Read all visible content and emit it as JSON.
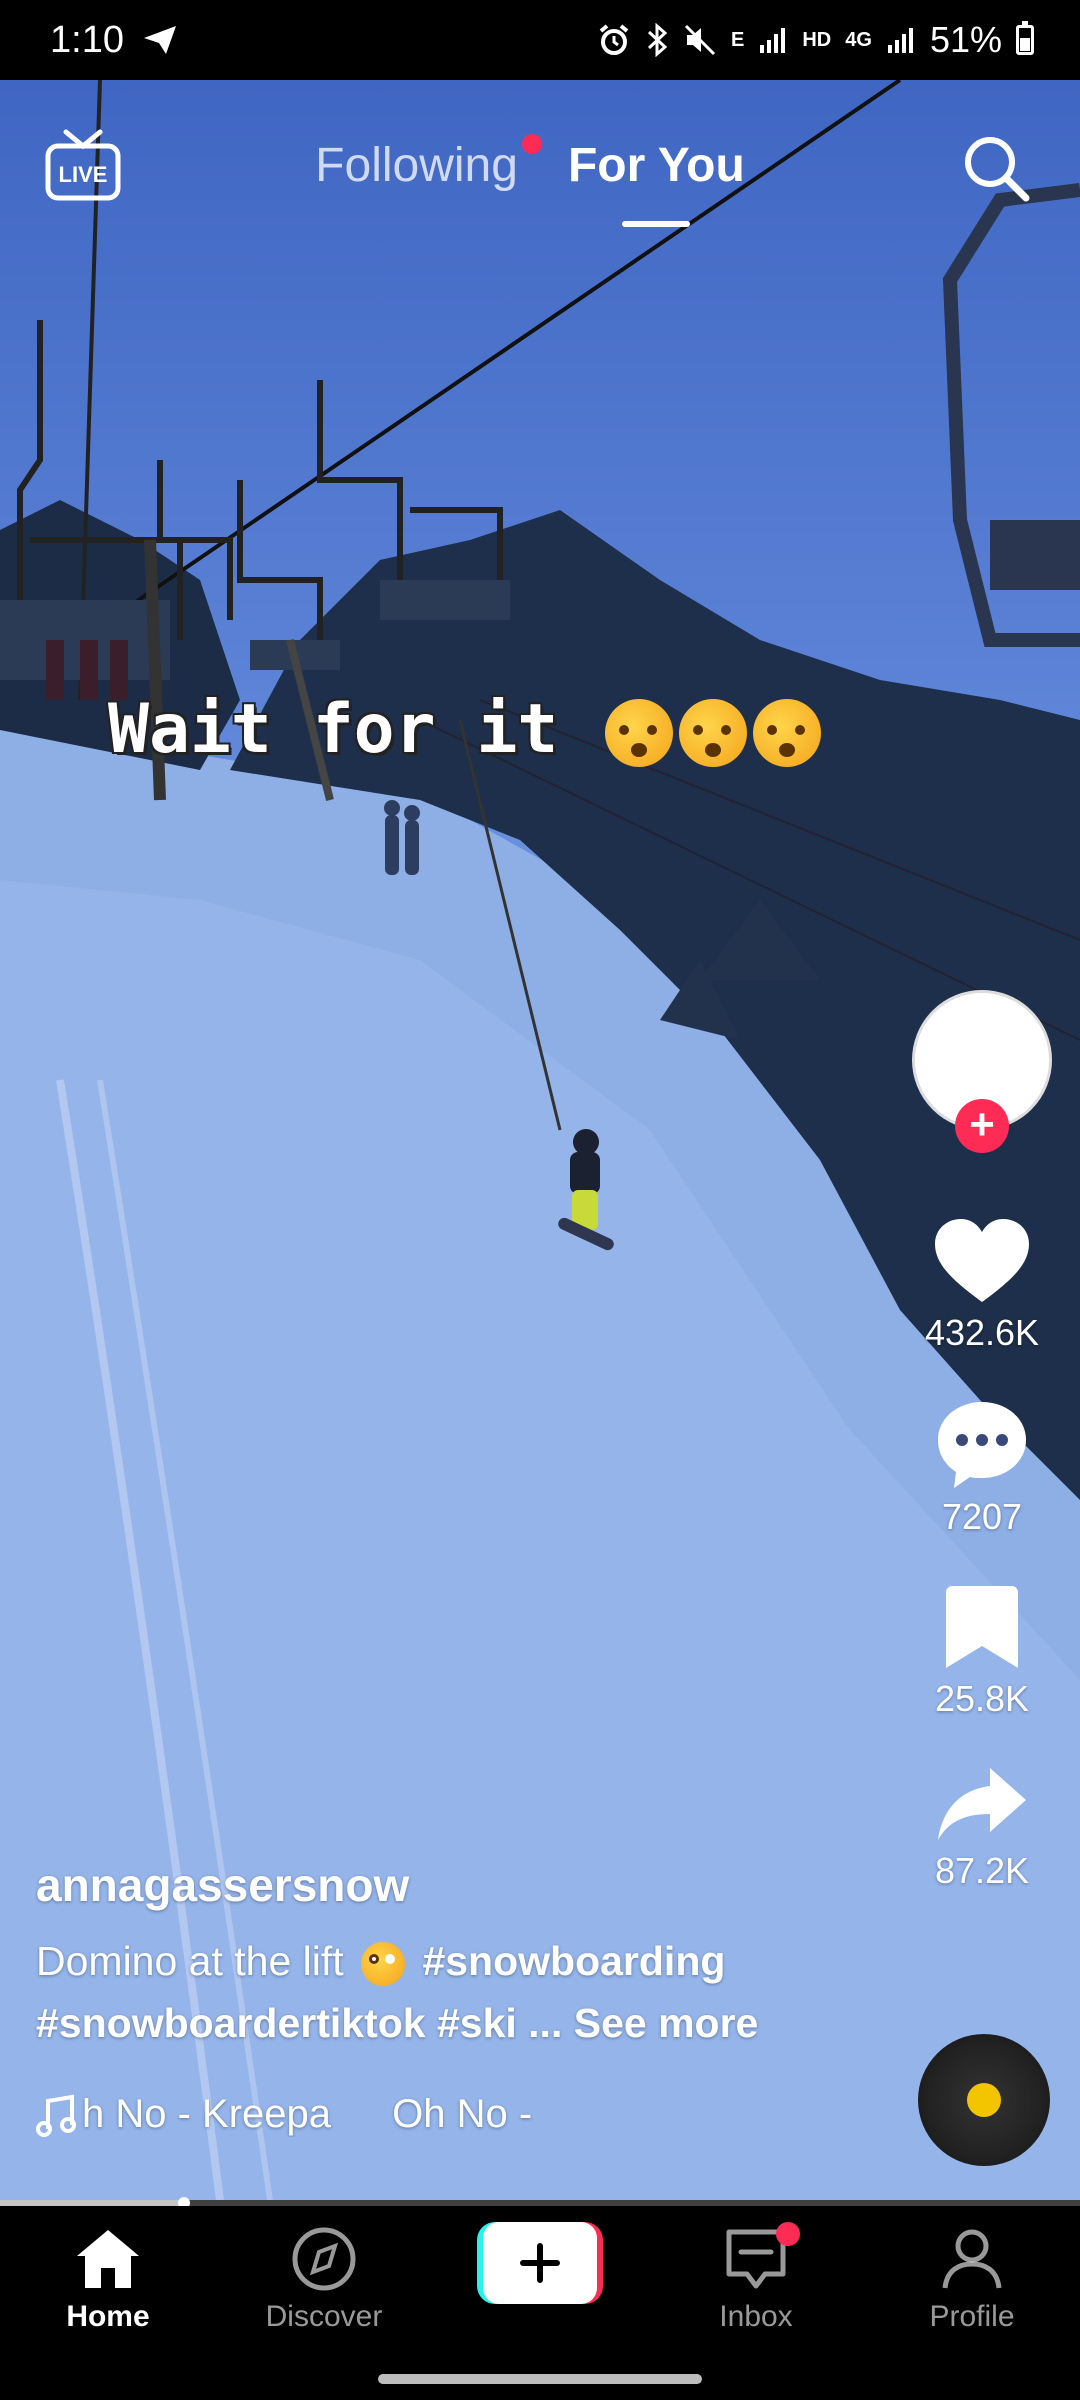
{
  "status_bar": {
    "time": "1:10",
    "network_small": "E",
    "hd": "HD",
    "net_4g": "4G",
    "battery": "51%"
  },
  "top_bar": {
    "live_label": "LIVE",
    "tab_following": "Following",
    "tab_for_you": "For You",
    "active_tab": "For You"
  },
  "video": {
    "overlay_text": "Wait for it",
    "progress": 0.17
  },
  "actions": {
    "likes": "432.6K",
    "comments": "7207",
    "bookmarks": "25.8K",
    "shares": "87.2K"
  },
  "post": {
    "username": "annagassersnow",
    "caption_part1": "Domino at the lift",
    "hashtag1": "#snowboarding",
    "caption_line2": "#snowboardertiktok #ski ...",
    "see_more": "See more",
    "music_a": "h No - Kreepa",
    "music_b": "Oh No -"
  },
  "bottom_nav": {
    "home": "Home",
    "discover": "Discover",
    "inbox": "Inbox",
    "profile": "Profile"
  },
  "colors": {
    "accent_red": "#fe2c55",
    "create_cyan": "#25f4ee",
    "disc_center": "#f2c500"
  }
}
